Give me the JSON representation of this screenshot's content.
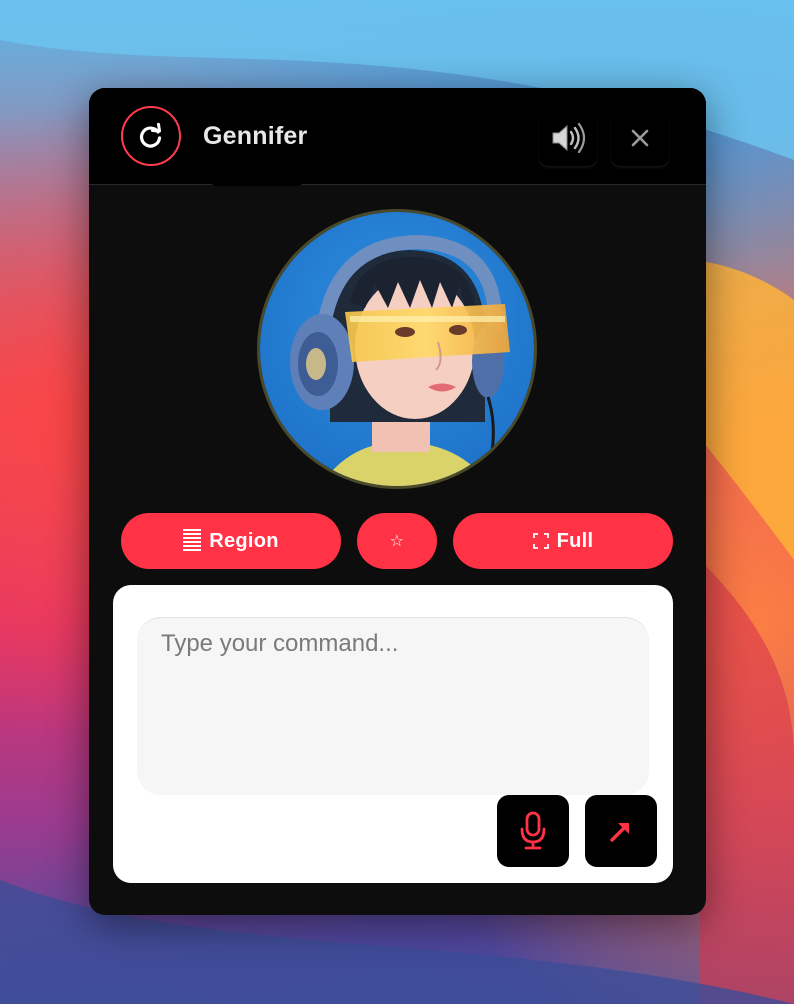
{
  "app": {
    "title": "Gennifer"
  },
  "header": {
    "logo_icon": "refresh-icon",
    "speaker_icon": "speaker-icon",
    "close_glyph": "✕"
  },
  "capture_buttons": {
    "region_label": "Region",
    "region_icon": "region-lines-icon",
    "star_glyph": "☆",
    "full_label": "Full",
    "full_icon": "fullscreen-corners-icon"
  },
  "command": {
    "placeholder": "Type your command..."
  },
  "actions": {
    "mic_icon": "microphone-icon",
    "send_icon": "arrow-up-right-icon"
  },
  "colors": {
    "accent": "#ff3246",
    "window_bg": "#0d0d0d",
    "header_bg": "#000000"
  }
}
